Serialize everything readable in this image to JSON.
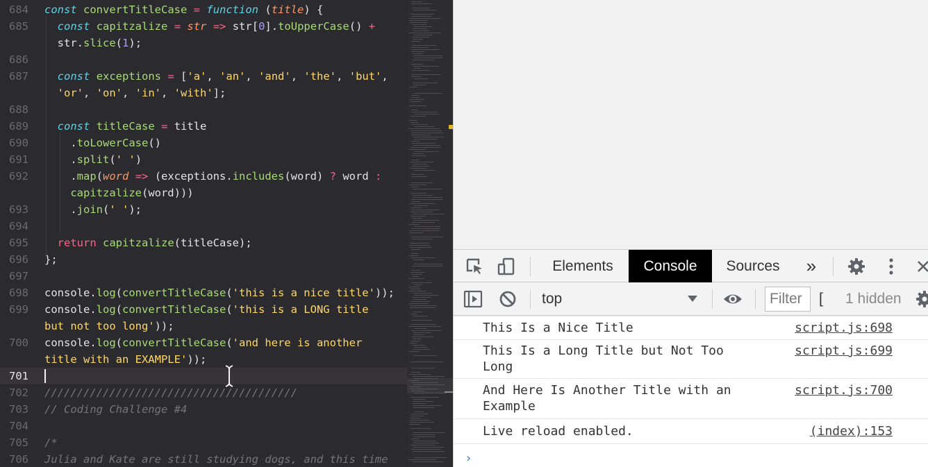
{
  "editor": {
    "lines": [
      {
        "no": "684",
        "html": "<span class=\"k\">const</span> <span class=\"v\">convertTitleCase</span> <span class=\"p\">=</span> <span class=\"k\">function</span> (<span class=\"a\">title</span>) {"
      },
      {
        "no": "685",
        "html": "  <span class=\"k\">const</span> <span class=\"v\">capitzalize</span> <span class=\"p\">=</span> <span class=\"a\">str</span> <span class=\"p\">=></span> str[<span class=\"n\">0</span>].<span class=\"v\">toUpperCase</span>() <span class=\"p\">+</span>"
      },
      {
        "no": "",
        "html": "  str.<span class=\"v\">slice</span>(<span class=\"n\">1</span>);"
      },
      {
        "no": "686",
        "html": ""
      },
      {
        "no": "687",
        "html": "  <span class=\"k\">const</span> <span class=\"v\">exceptions</span> <span class=\"p\">=</span> [<span class=\"s\">'a'</span>, <span class=\"s\">'an'</span>, <span class=\"s\">'and'</span>, <span class=\"s\">'the'</span>, <span class=\"s\">'but'</span>,"
      },
      {
        "no": "",
        "html": "  <span class=\"s\">'or'</span>, <span class=\"s\">'on'</span>, <span class=\"s\">'in'</span>, <span class=\"s\">'with'</span>];"
      },
      {
        "no": "688",
        "html": ""
      },
      {
        "no": "689",
        "html": "  <span class=\"k\">const</span> <span class=\"v\">titleCase</span> <span class=\"p\">=</span> title"
      },
      {
        "no": "690",
        "html": "    .<span class=\"v\">toLowerCase</span>()"
      },
      {
        "no": "691",
        "html": "    .<span class=\"v\">split</span>(<span class=\"s\">' '</span>)"
      },
      {
        "no": "692",
        "html": "    .<span class=\"v\">map</span>(<span class=\"a\">word</span> <span class=\"p\">=></span> (exceptions.<span class=\"v\">includes</span>(word) <span class=\"p\">?</span> word <span class=\"p\">:</span>"
      },
      {
        "no": "",
        "html": "    <span class=\"v\">capitzalize</span>(word)))"
      },
      {
        "no": "693",
        "html": "    .<span class=\"v\">join</span>(<span class=\"s\">' '</span>);"
      },
      {
        "no": "694",
        "html": ""
      },
      {
        "no": "695",
        "html": "  <span class=\"r\">return</span> <span class=\"v\">capitzalize</span>(titleCase);"
      },
      {
        "no": "696",
        "html": "};"
      },
      {
        "no": "697",
        "html": ""
      },
      {
        "no": "698",
        "html": "console.<span class=\"v\">log</span>(<span class=\"v\">convertTitleCase</span>(<span class=\"s\">'this is a nice title'</span>));"
      },
      {
        "no": "699",
        "html": "console.<span class=\"v\">log</span>(<span class=\"v\">convertTitleCase</span>(<span class=\"s\">'this is a LONG title</span>"
      },
      {
        "no": "",
        "html": "<span class=\"s\">but not too long'</span>));"
      },
      {
        "no": "700",
        "html": "console.<span class=\"v\">log</span>(<span class=\"v\">convertTitleCase</span>(<span class=\"s\">'and here is another</span>"
      },
      {
        "no": "",
        "html": "<span class=\"s\">title with an EXAMPLE'</span>));"
      },
      {
        "no": "701",
        "html": "",
        "current": true
      },
      {
        "no": "702",
        "html": "<span class=\"c\">///////////////////////////////////////</span>"
      },
      {
        "no": "703",
        "html": "<span class=\"c\">// Coding Challenge #4</span>"
      },
      {
        "no": "704",
        "html": ""
      },
      {
        "no": "705",
        "html": "<span class=\"c\">/*</span>"
      },
      {
        "no": "706",
        "html": "<span class=\"c\">Julia and Kate are still studying dogs, and this time</span>"
      }
    ]
  },
  "devtools": {
    "tabs": [
      "Elements",
      "Console",
      "Sources"
    ],
    "active_tab": "Console",
    "more_tabs": "»",
    "context": "top",
    "filter_placeholder": "Filter",
    "levels_stub": "[",
    "hidden": "1 hidden",
    "messages": [
      {
        "text": "This Is a Nice Title",
        "source": "script.js:698"
      },
      {
        "text": "This Is a Long Title but Not Too\nLong",
        "source": "script.js:699"
      },
      {
        "text": "And Here Is Another Title with an\nExample",
        "source": "script.js:700"
      },
      {
        "text": "Live reload enabled.",
        "source": "(index):153"
      }
    ],
    "prompt": "›"
  },
  "icons": [
    "inspect-icon",
    "device-toggle-icon",
    "settings-gear-icon",
    "kebab-menu-icon",
    "close-icon",
    "sidebar-toggle-icon",
    "clear-console-icon",
    "dropdown-caret-icon",
    "eye-icon",
    "text-cursor-icon"
  ]
}
